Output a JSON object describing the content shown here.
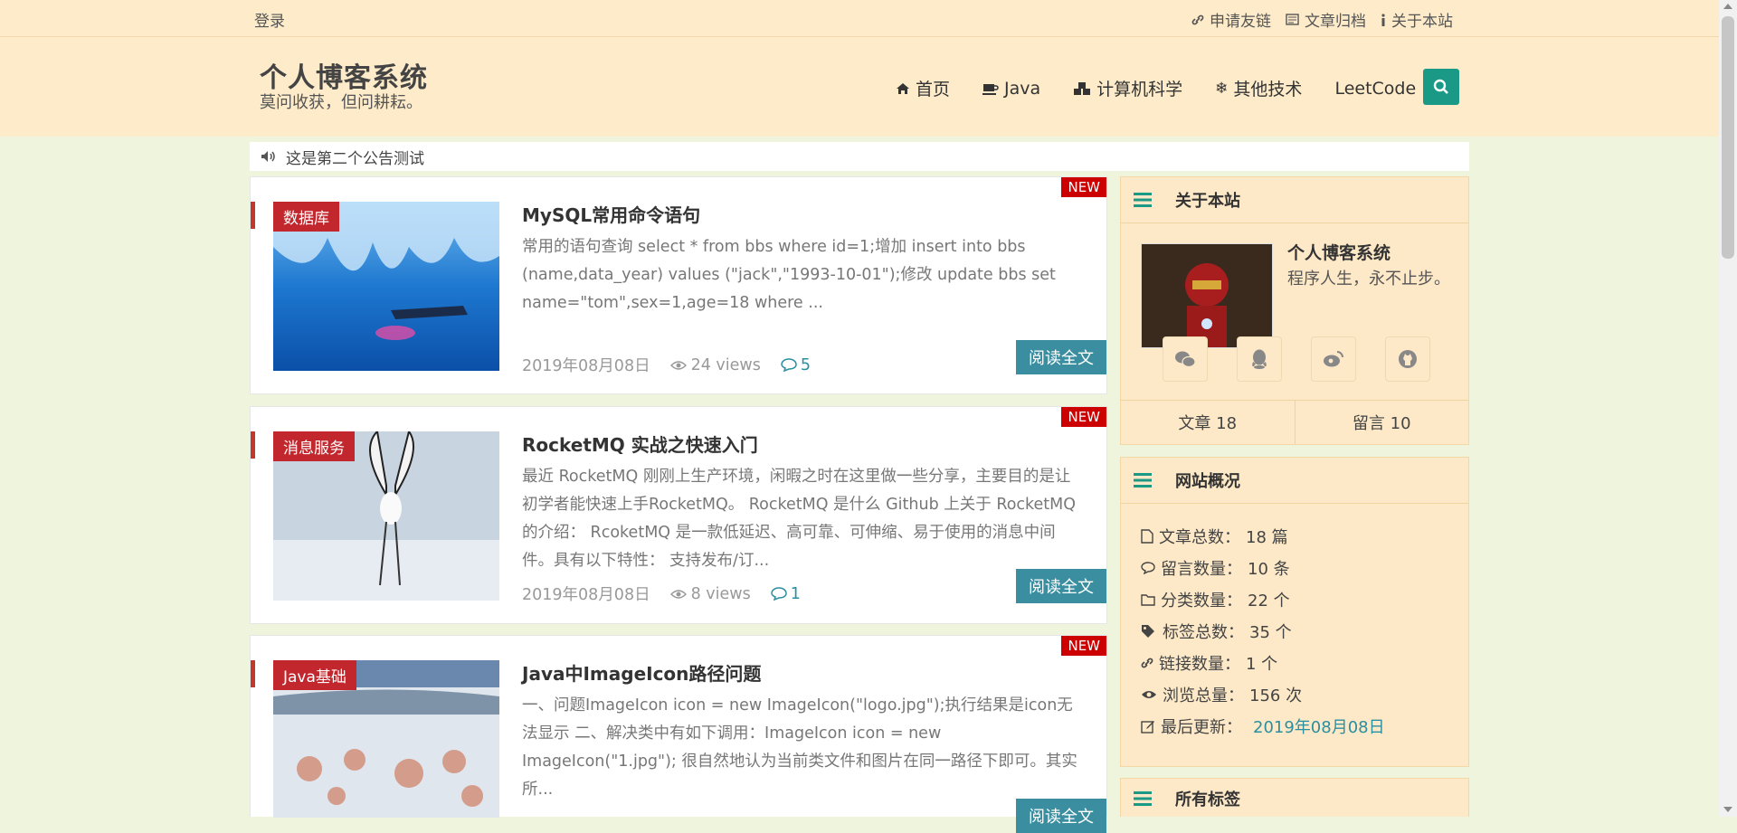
{
  "topbar": {
    "login": "登录",
    "links": [
      "申请友链",
      "文章归档",
      "关于本站"
    ]
  },
  "header": {
    "title": "个人博客系统",
    "subtitle": "莫问收获，但问耕耘。",
    "nav": [
      "首页",
      "Java",
      "计算机科学",
      "其他技术",
      "LeetCode"
    ]
  },
  "notice": "这是第二个公告测试",
  "posts": [
    {
      "category": "数据库",
      "badge": "NEW",
      "title": "MySQL常用命令语句",
      "summary": "常用的语句查询 select * from bbs where id=1;增加 insert into bbs (name,data_year) values (\"jack\",\"1993-10-01\");修改 update bbs set name=\"tom\",sex=1,age=18 where ...",
      "date": "2019年08月08日",
      "views": "24 views",
      "comments": "5",
      "read": "阅读全文"
    },
    {
      "category": "消息服务",
      "badge": "NEW",
      "title": "RocketMQ 实战之快速入门",
      "summary": "最近 RocketMQ 刚刚上生产环境，闲暇之时在这里做一些分享，主要目的是让初学者能快速上手RocketMQ。 RocketMQ 是什么 Github 上关于 RocketMQ 的介绍： RcoketMQ 是一款低延迟、高可靠、可伸缩、易于使用的消息中间件。具有以下特性： 支持发布/订...",
      "date": "2019年08月08日",
      "views": "8 views",
      "comments": "1",
      "read": "阅读全文"
    },
    {
      "category": "Java基础",
      "badge": "NEW",
      "title": "Java中ImageIcon路径问题",
      "summary": "一、问题ImageIcon icon = new ImageIcon(\"logo.jpg\");执行结果是icon无法显示 二、解决类中有如下调用：ImageIcon icon = new ImageIcon(\"1.jpg\"); 很自然地认为当前类文件和图片在同一路径下即可。其实所...",
      "read": "阅读全文"
    }
  ],
  "sidebar": {
    "about": {
      "heading": "关于本站",
      "name": "个人博客系统",
      "motto": "程序人生，永不止步。",
      "articles": "文章 18",
      "messages": "留言 10"
    },
    "overview": {
      "heading": "网站概况",
      "rows": [
        {
          "label": "文章总数：",
          "value": "18 篇"
        },
        {
          "label": "留言数量：",
          "value": "10 条"
        },
        {
          "label": "分类数量：",
          "value": "22 个"
        },
        {
          "label": "标签总数：",
          "value": "35 个"
        },
        {
          "label": "链接数量：",
          "value": "1 个"
        },
        {
          "label": "浏览总量：",
          "value": "156 次"
        },
        {
          "label": "最后更新：",
          "value": "2019年08月08日"
        }
      ]
    },
    "tags": {
      "heading": "所有标签"
    }
  },
  "colors": {
    "accent": "#1a9a86",
    "category": "#c1272d",
    "read_button": "#3a8ea0",
    "header_bg": "#fdebc9",
    "page_bg": "#eef5dc"
  }
}
